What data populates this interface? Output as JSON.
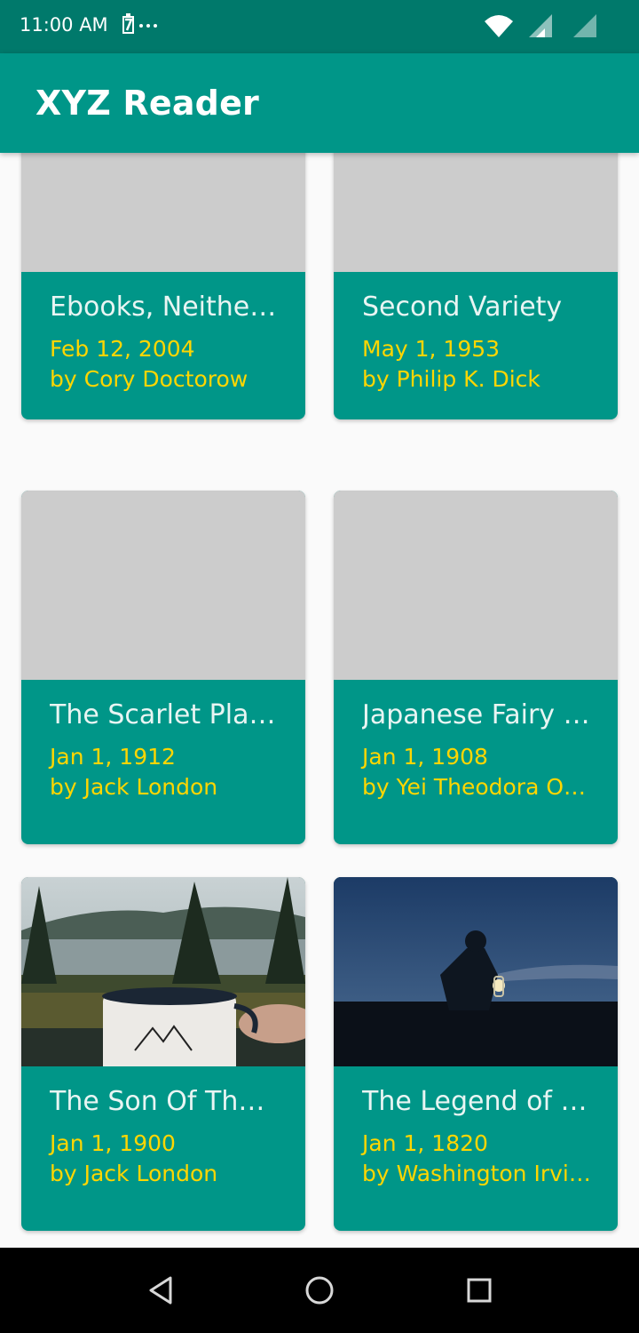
{
  "status_bar": {
    "time": "11:00 AM",
    "notification_glyph": "7···",
    "icons": [
      "wifi-icon",
      "cell-signal-icon",
      "cell-signal-empty-icon"
    ]
  },
  "app_bar": {
    "title": "XYZ Reader"
  },
  "colors": {
    "primary": "#009688",
    "primary_dark": "#00796b",
    "accent": "#ffd600",
    "placeholder": "#cccccc",
    "background": "#fafafa"
  },
  "articles": [
    {
      "title": "Ebooks, Neither E-, Nor Books",
      "display_title": "Ebooks, Neither …",
      "date": "Feb 12, 2004",
      "author": "by Cory Doctorow",
      "has_image": false
    },
    {
      "title": "Second Variety",
      "display_title": "Second Variety",
      "date": "May 1, 1953",
      "author": "by Philip K. Dick",
      "has_image": false
    },
    {
      "title": "The Scarlet Plague",
      "display_title": "The Scarlet Plag…",
      "date": "Jan 1, 1912",
      "author": "by Jack London",
      "has_image": false
    },
    {
      "title": "Japanese Fairy Tales",
      "display_title": "Japanese Fairy …",
      "date": "Jan 1, 1908",
      "author": "by Yei Theodora O…",
      "has_image": false
    },
    {
      "title": "The Son Of The Wolf",
      "display_title": "The Son Of The …",
      "date": "Jan 1, 1900",
      "author": "by Jack London",
      "has_image": true,
      "image": "camping-mug-lake-photo"
    },
    {
      "title": "The Legend of Sleepy Hollow",
      "display_title": "The Legend of S…",
      "date": "Jan 1, 1820",
      "author": "by Washington Irvi…",
      "has_image": true,
      "image": "lantern-night-photo"
    }
  ],
  "nav_bar": {
    "buttons": [
      "back-icon",
      "home-icon",
      "recents-icon"
    ]
  }
}
